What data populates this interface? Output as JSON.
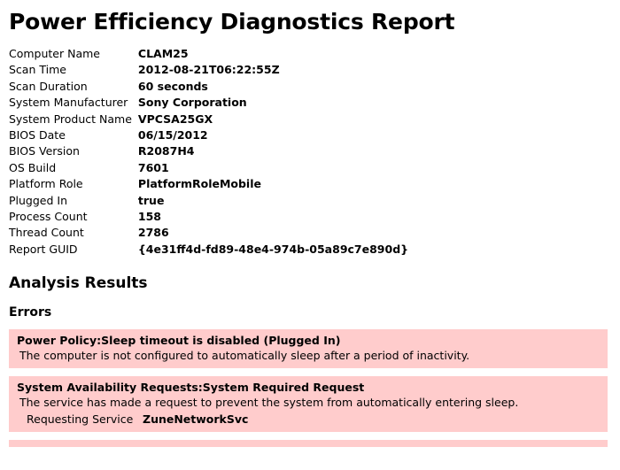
{
  "report": {
    "title": "Power Efficiency Diagnostics Report"
  },
  "system_info": {
    "rows": [
      {
        "label": "Computer Name",
        "value": "CLAM25"
      },
      {
        "label": "Scan Time",
        "value": "2012-08-21T06:22:55Z"
      },
      {
        "label": "Scan Duration",
        "value": "60 seconds"
      },
      {
        "label": "System Manufacturer",
        "value": "Sony Corporation"
      },
      {
        "label": "System Product Name",
        "value": "VPCSA25GX"
      },
      {
        "label": "BIOS Date",
        "value": "06/15/2012"
      },
      {
        "label": "BIOS Version",
        "value": "R2087H4"
      },
      {
        "label": "OS Build",
        "value": "7601"
      },
      {
        "label": "Platform Role",
        "value": "PlatformRoleMobile"
      },
      {
        "label": "Plugged In",
        "value": "true"
      },
      {
        "label": "Process Count",
        "value": "158"
      },
      {
        "label": "Thread Count",
        "value": "2786"
      },
      {
        "label": "Report GUID",
        "value": "{4e31ff4d-fd89-48e4-974b-05a89c7e890d}"
      }
    ]
  },
  "analysis": {
    "heading": "Analysis Results",
    "errors_heading": "Errors",
    "errors": [
      {
        "title": "Power Policy:Sleep timeout is disabled (Plugged In)",
        "description": "The computer is not configured to automatically sleep after a period of inactivity.",
        "details": []
      },
      {
        "title": "System Availability Requests:System Required Request",
        "description": "The service has made a request to prevent the system from automatically entering sleep.",
        "details": [
          {
            "label": "Requesting Service",
            "value": "ZuneNetworkSvc"
          }
        ]
      },
      {
        "title": "",
        "description": "",
        "details": [],
        "truncated": true
      }
    ]
  },
  "colors": {
    "error_background": "#ffcccc",
    "page_background": "#ffffff",
    "text": "#000000"
  }
}
